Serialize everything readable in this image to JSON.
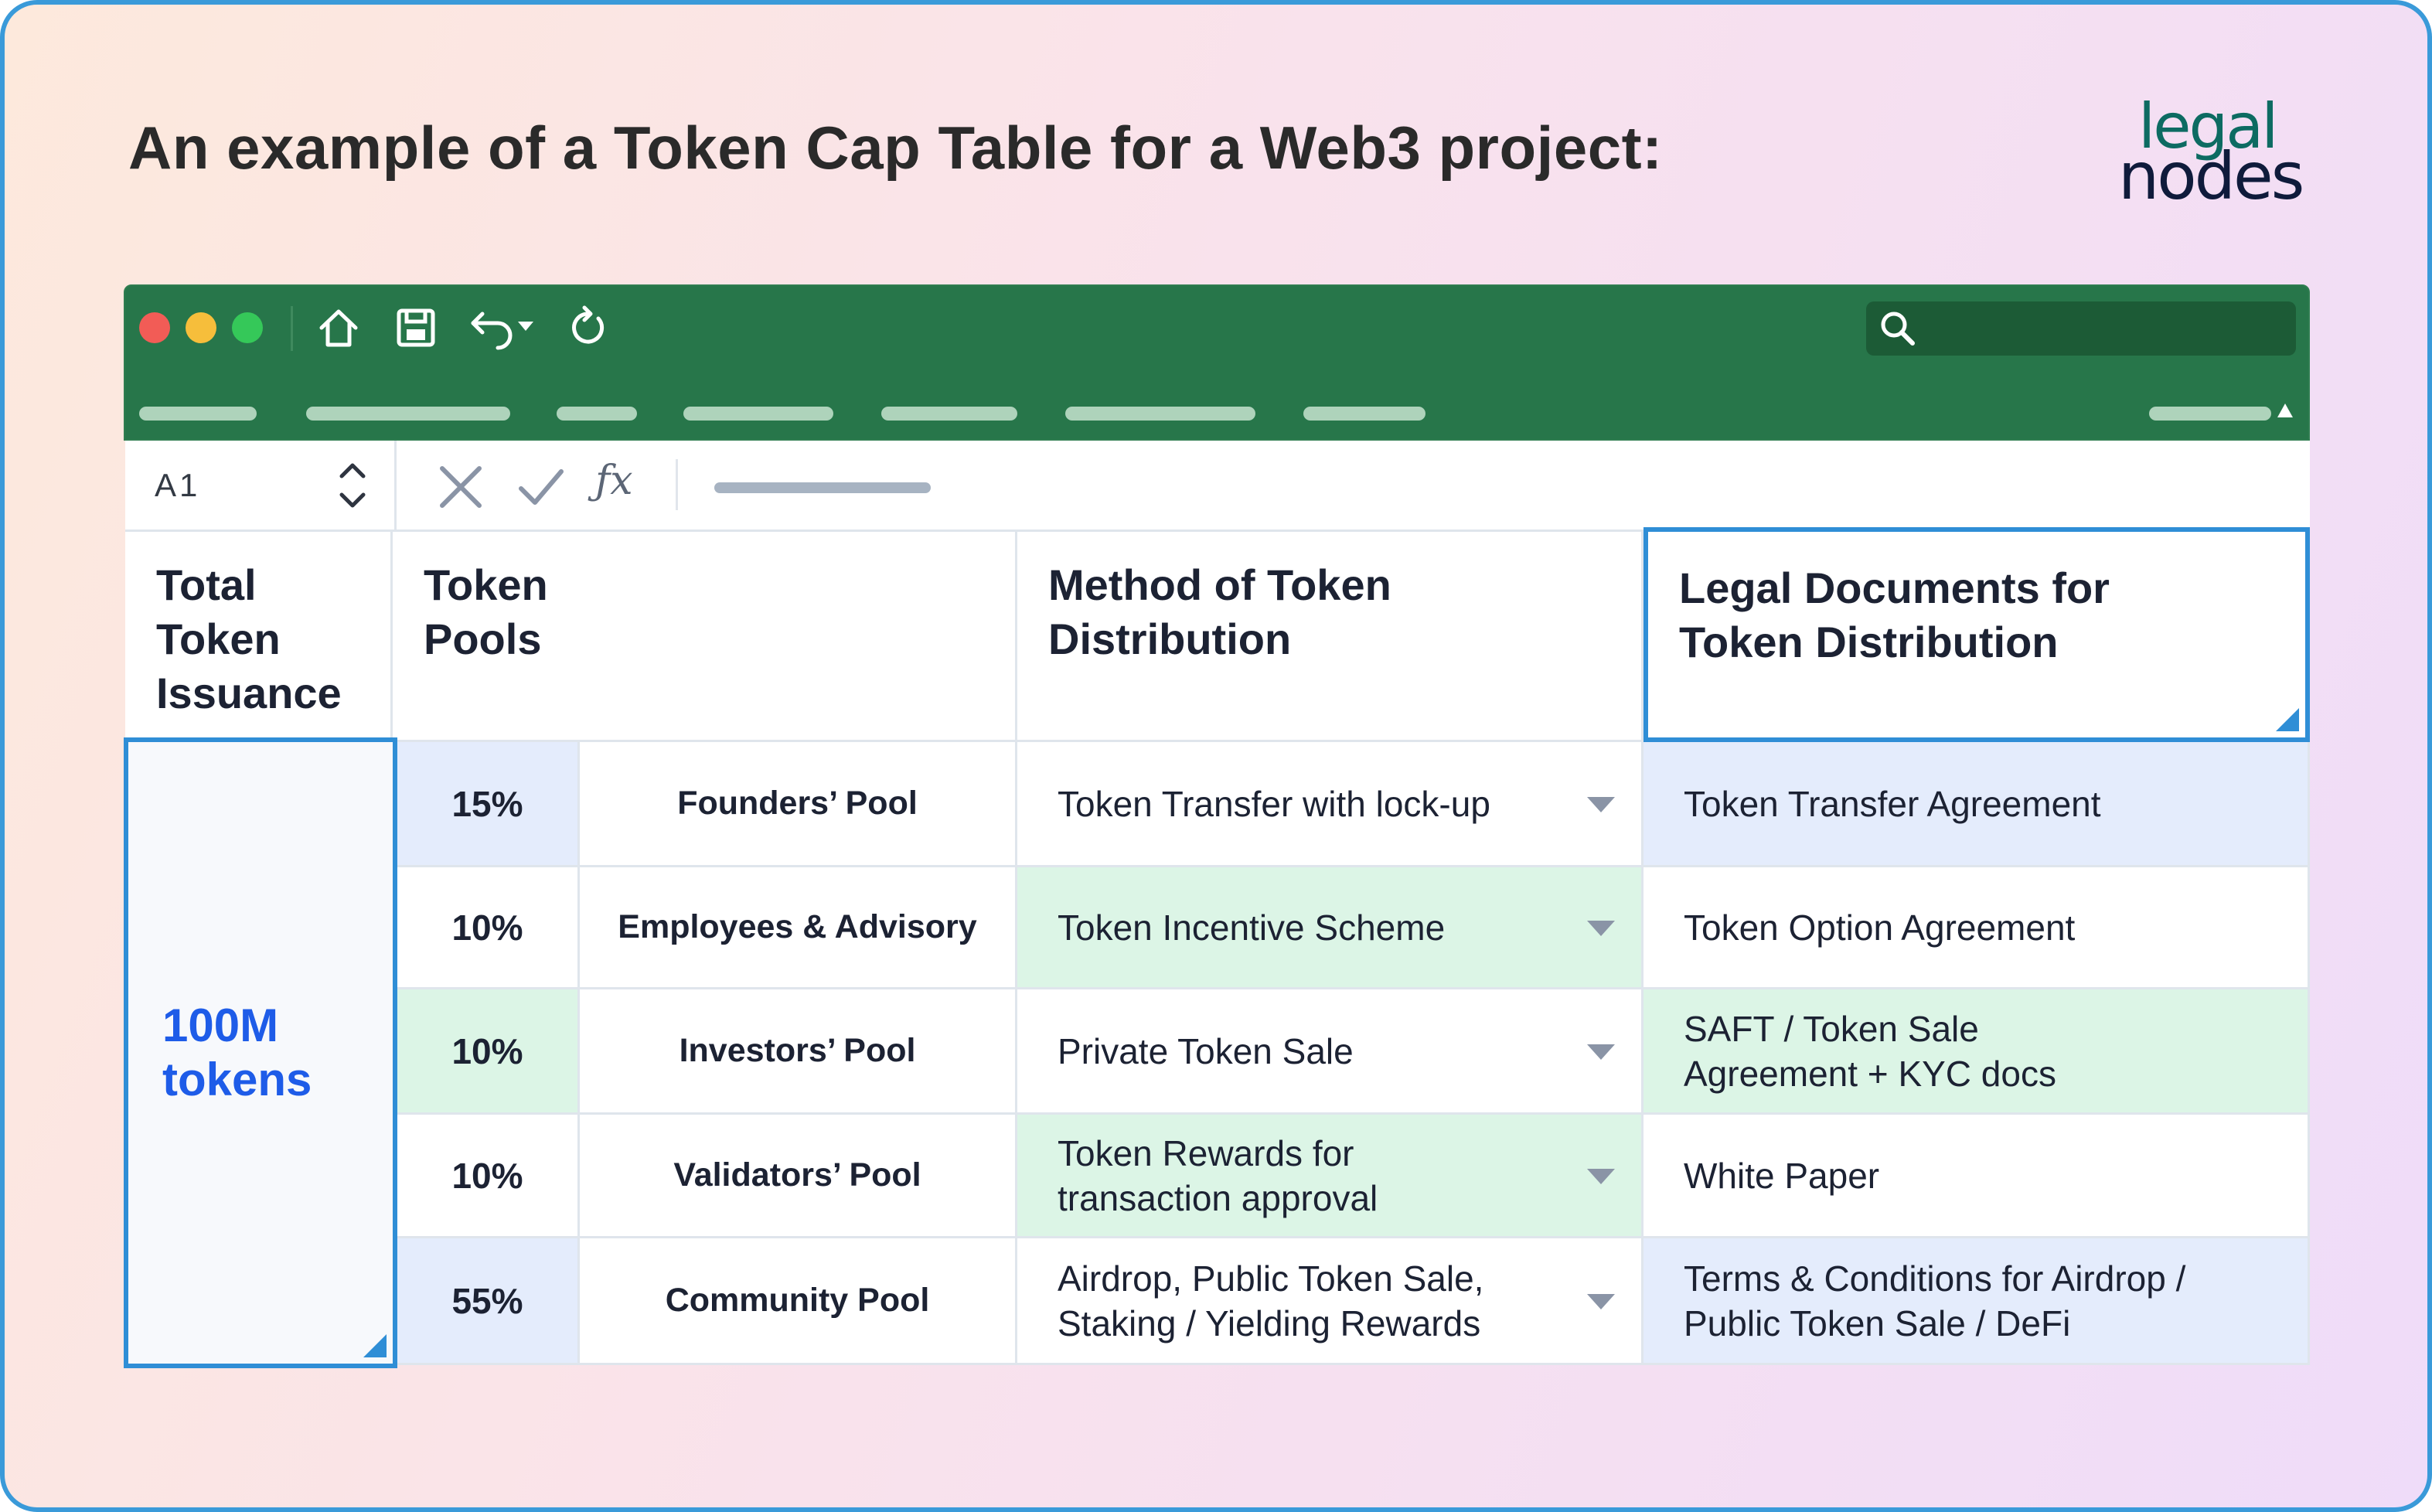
{
  "headline": "An example of a Token Cap Table for a Web3 project:",
  "logo": {
    "line1": "legal",
    "line2": "nodes"
  },
  "colors": {
    "ribbon_green": "#27764a",
    "selection_blue": "#2f8ed6",
    "highlight_blue": "#e4ecfc",
    "highlight_green": "#dcf5e6",
    "total_text_blue": "#1e5ce8"
  },
  "toolbar": {
    "icons": [
      "home-icon",
      "save-icon",
      "undo-icon",
      "refresh-icon",
      "search-icon"
    ]
  },
  "formula_bar": {
    "cell_ref": "A1",
    "icons": [
      "cancel-icon",
      "confirm-icon",
      "function-icon"
    ],
    "function_label": "ƒx"
  },
  "table": {
    "headers": {
      "total": [
        "Total",
        "Token",
        "Issuance"
      ],
      "pools": [
        "Token",
        "Pools"
      ],
      "method": [
        "Method of Token",
        "Distribution"
      ],
      "legal": [
        "Legal Documents for",
        "Token Distribution"
      ]
    },
    "total_issuance": [
      "100M",
      "tokens"
    ],
    "rows": [
      {
        "percent": "15%",
        "pool": "Founders’ Pool",
        "method": [
          "Token Transfer with lock-up"
        ],
        "legal": [
          "Token Transfer Agreement"
        ]
      },
      {
        "percent": "10%",
        "pool": "Employees & Advisory",
        "method": [
          "Token Incentive Scheme"
        ],
        "legal": [
          "Token Option Agreement"
        ]
      },
      {
        "percent": "10%",
        "pool": "Investors’ Pool",
        "method": [
          "Private Token Sale"
        ],
        "legal": [
          "SAFT / Token Sale",
          "Agreement + KYC docs"
        ]
      },
      {
        "percent": "10%",
        "pool": "Validators’ Pool",
        "method": [
          "Token Rewards for",
          "transaction approval"
        ],
        "legal": [
          "White Paper"
        ]
      },
      {
        "percent": "55%",
        "pool": "Community Pool",
        "method": [
          "Airdrop, Public Token Sale,",
          "Staking / Yielding Rewards"
        ],
        "legal": [
          "Terms & Conditions for Airdrop /",
          "Public Token Sale / DeFi"
        ]
      }
    ]
  }
}
